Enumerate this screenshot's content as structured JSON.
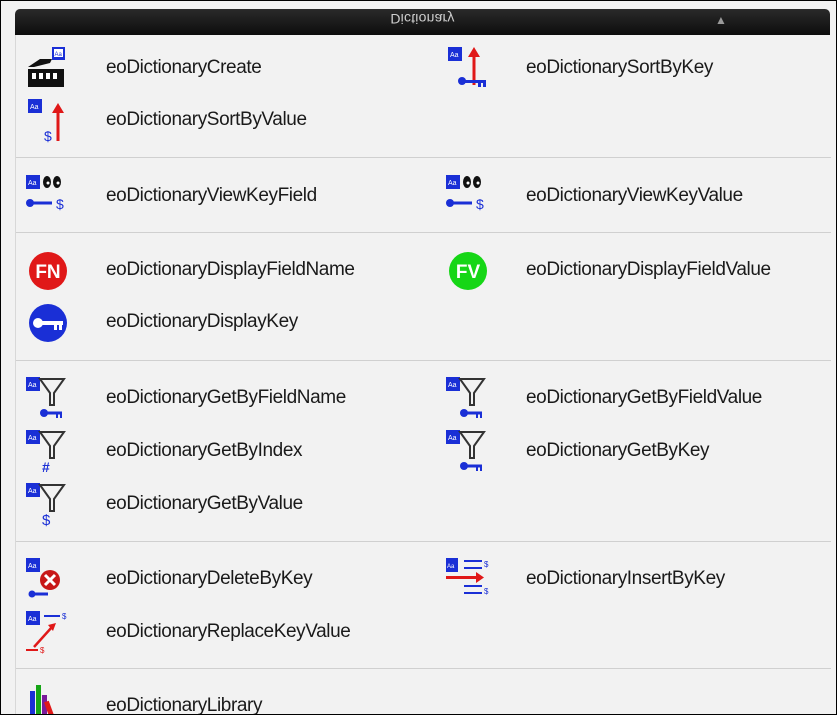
{
  "window": {
    "title": "Dictionary",
    "pin_icon": "pin-icon"
  },
  "groups": [
    {
      "items": [
        {
          "label": "eoDictionaryCreate",
          "icon": "dictionary-create-icon"
        },
        {
          "label": "eoDictionarySortByKey",
          "icon": "sort-by-key-icon"
        },
        {
          "label": "eoDictionarySortByValue",
          "icon": "sort-by-value-icon"
        }
      ]
    },
    {
      "items": [
        {
          "label": "eoDictionaryViewKeyField",
          "icon": "view-key-field-icon"
        },
        {
          "label": "eoDictionaryViewKeyValue",
          "icon": "view-key-value-icon"
        }
      ]
    },
    {
      "items": [
        {
          "label": "eoDictionaryDisplayFieldName",
          "icon": "fn-badge-icon",
          "badge_text": "FN"
        },
        {
          "label": "eoDictionaryDisplayFieldValue",
          "icon": "fv-badge-icon",
          "badge_text": "FV"
        },
        {
          "label": "eoDictionaryDisplayKey",
          "icon": "key-badge-icon"
        }
      ]
    },
    {
      "items": [
        {
          "label": "eoDictionaryGetByFieldName",
          "icon": "filter-key-icon"
        },
        {
          "label": "eoDictionaryGetByFieldValue",
          "icon": "filter-key-icon"
        },
        {
          "label": "eoDictionaryGetByIndex",
          "icon": "filter-index-icon"
        },
        {
          "label": "eoDictionaryGetByKey",
          "icon": "filter-key-icon"
        },
        {
          "label": "eoDictionaryGetByValue",
          "icon": "filter-dollar-icon"
        }
      ]
    },
    {
      "items": [
        {
          "label": "eoDictionaryDeleteByKey",
          "icon": "delete-icon"
        },
        {
          "label": "eoDictionaryInsertByKey",
          "icon": "insert-icon"
        },
        {
          "label": "eoDictionaryReplaceKeyValue",
          "icon": "replace-icon"
        }
      ]
    },
    {
      "items": [
        {
          "label": "eoDictionaryLibrary",
          "icon": "library-icon"
        }
      ]
    }
  ],
  "colors": {
    "blue": "#1a2fd6",
    "red": "#e01818",
    "green": "#16d616",
    "text": "#1a1a1a"
  }
}
